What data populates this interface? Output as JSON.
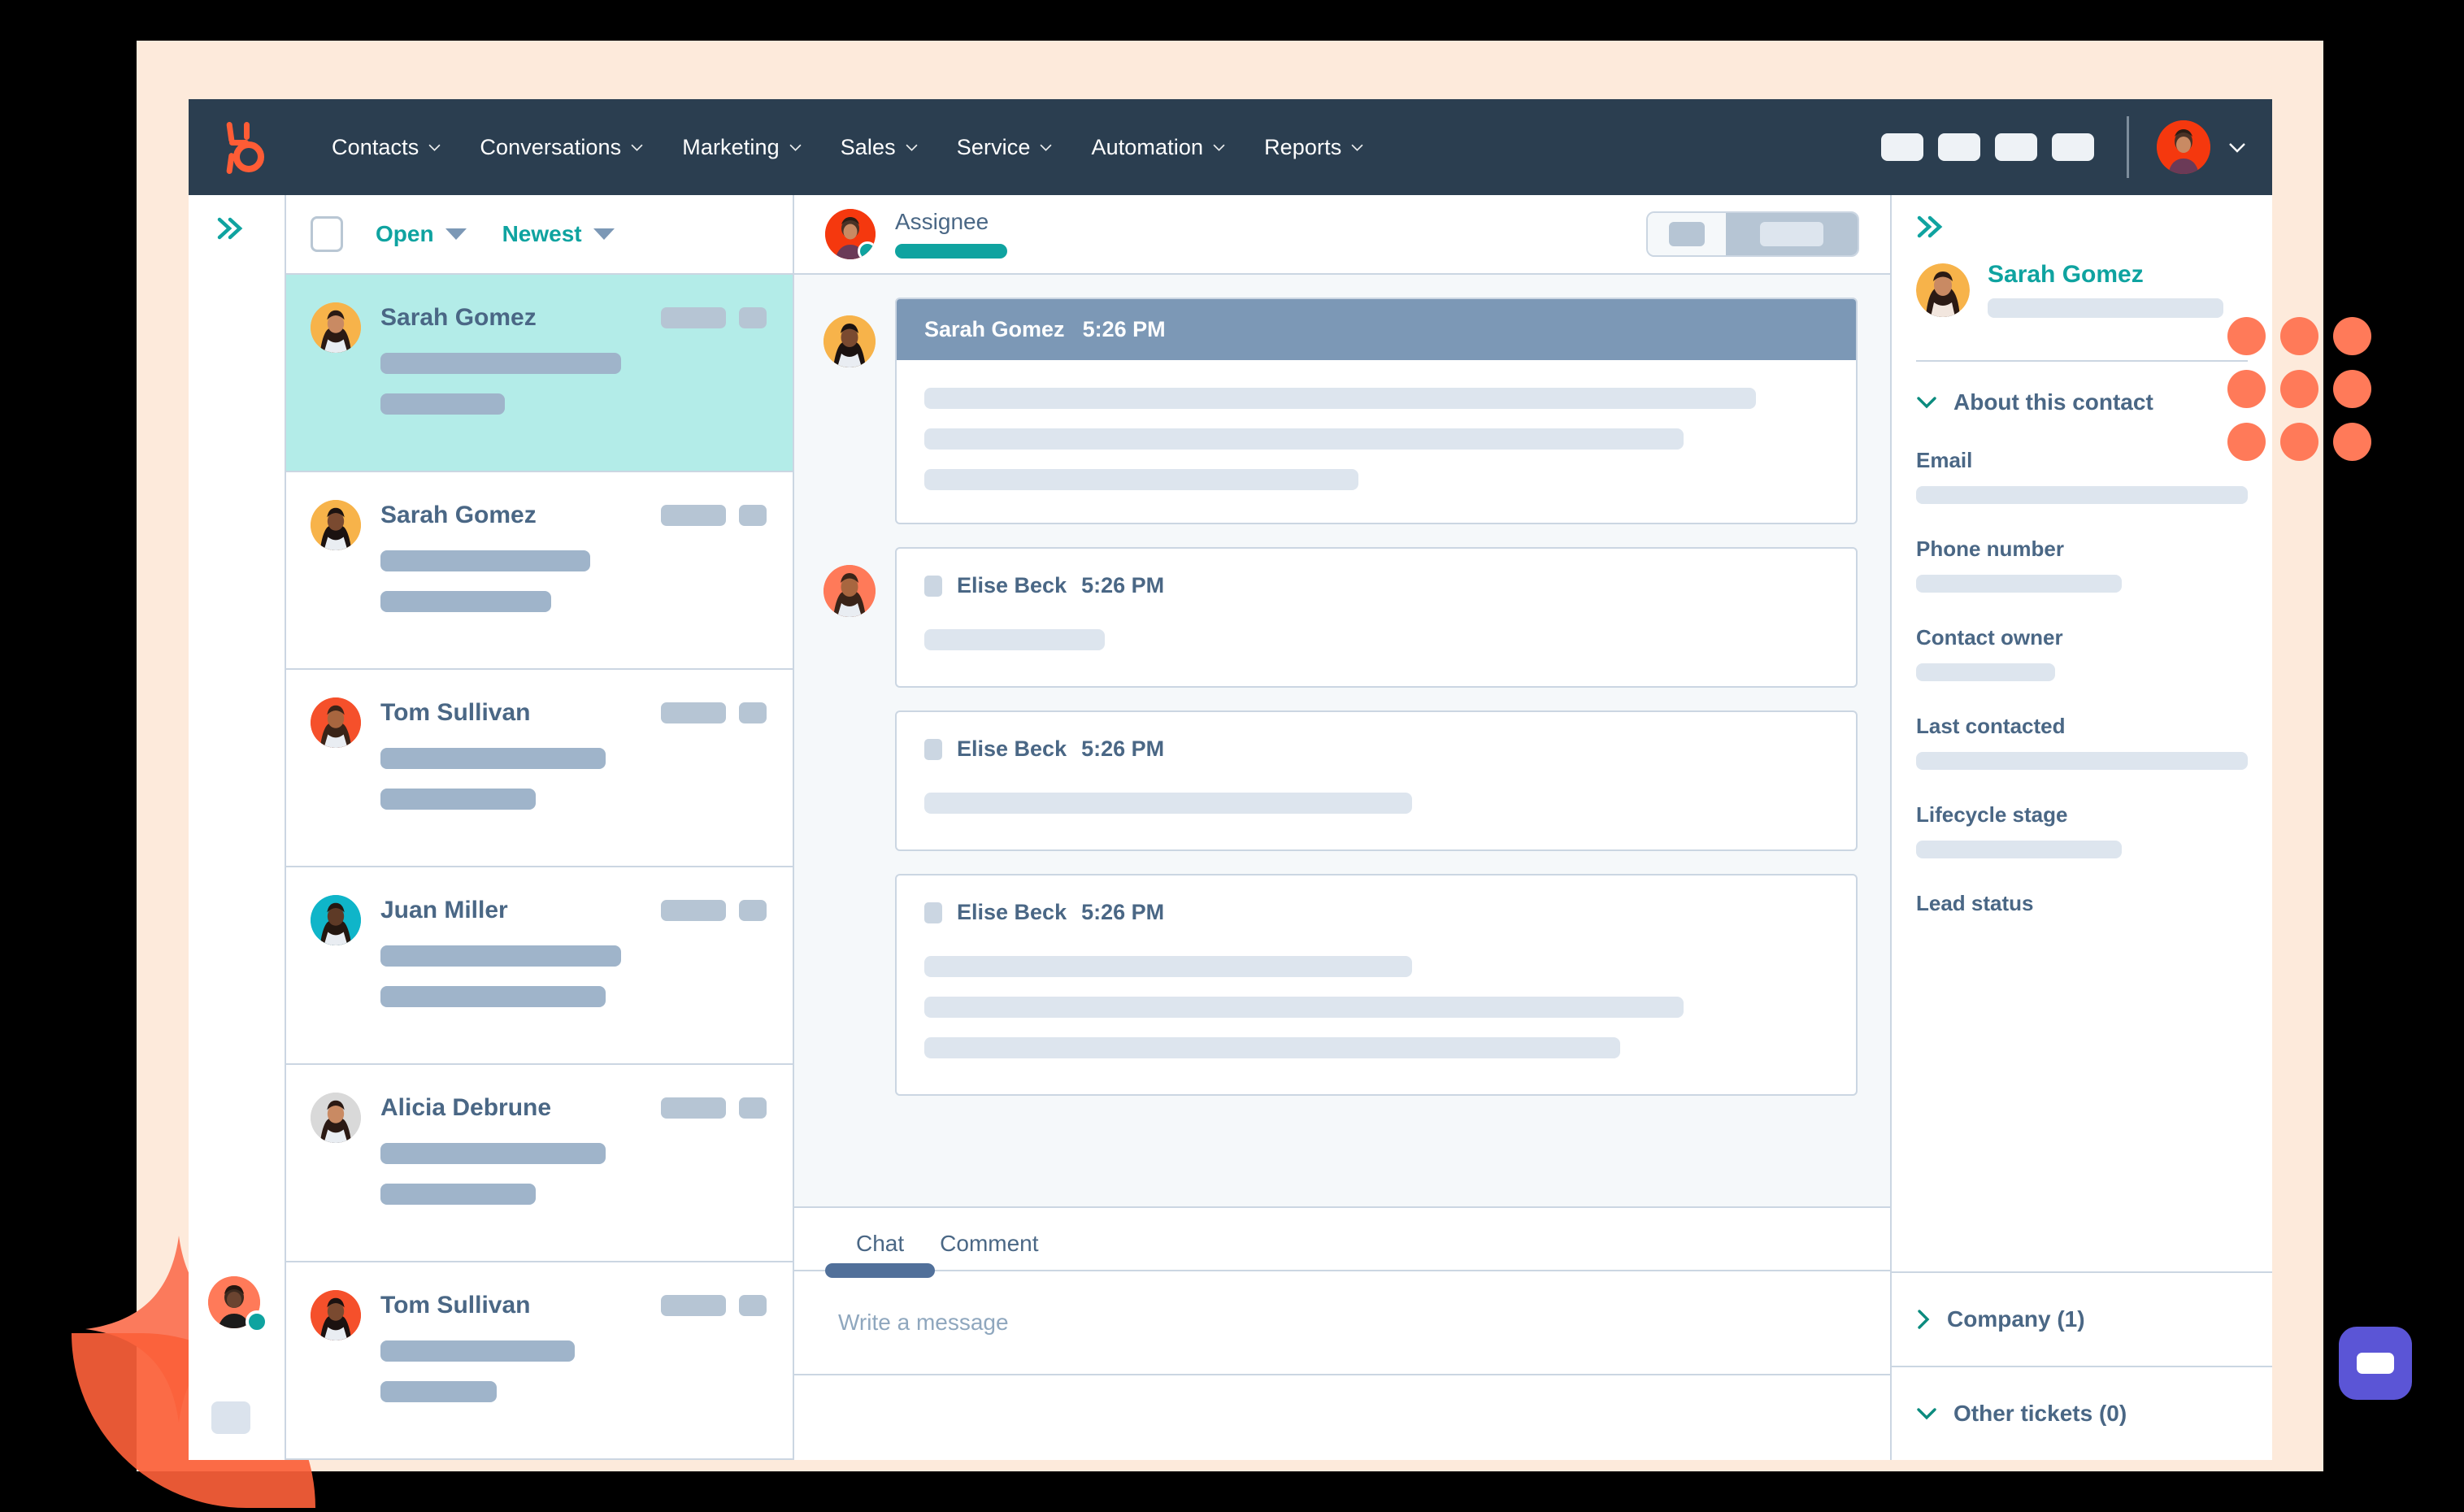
{
  "brand": {
    "accent_teal": "#0fa3a0",
    "accent_orange": "#ff7a59",
    "nav_bg": "#2b3e50",
    "slate": "#4a6785",
    "selected_row": "#b3ece8",
    "widget_purple": "#5b55d6"
  },
  "topnav": {
    "logo_name": "hubspot-sprocket-logo",
    "items": [
      {
        "label": "Contacts"
      },
      {
        "label": "Conversations"
      },
      {
        "label": "Marketing"
      },
      {
        "label": "Sales"
      },
      {
        "label": "Service"
      },
      {
        "label": "Automation"
      },
      {
        "label": "Reports"
      }
    ],
    "action_chip_count": 4,
    "avatar_name": "user-avatar",
    "caret_name": "chevron-down-icon"
  },
  "rail": {
    "collapse_icon": "double-chevron-right-icon",
    "avatar_name": "agent-avatar",
    "status": "online"
  },
  "conversation_list": {
    "toolbar": {
      "select_all_name": "select-all-checkbox",
      "status_filter": "Open",
      "sort_filter": "Newest"
    },
    "items": [
      {
        "name": "Sarah Gomez",
        "avatar_bg": "#f7b34a",
        "selected": true,
        "line1_w": "62%",
        "line2_w": "32%"
      },
      {
        "name": "Sarah Gomez",
        "avatar_bg": "#f7b34a",
        "selected": false,
        "line1_w": "54%",
        "line2_w": "44%"
      },
      {
        "name": "Tom Sullivan",
        "avatar_bg": "#f5502b",
        "selected": false,
        "line1_w": "58%",
        "line2_w": "40%"
      },
      {
        "name": "Juan Miller",
        "avatar_bg": "#0fb5c9",
        "selected": false,
        "line1_w": "62%",
        "line2_w": "58%"
      },
      {
        "name": "Alicia Debrune",
        "avatar_bg": "#d9d9d9",
        "selected": false,
        "line1_w": "58%",
        "line2_w": "40%"
      },
      {
        "name": "Tom Sullivan",
        "avatar_bg": "#f5502b",
        "selected": false,
        "line1_w": "50%",
        "line2_w": "30%"
      }
    ]
  },
  "thread": {
    "header": {
      "avatar_name": "assignee-avatar",
      "label": "Assignee",
      "status": "online",
      "segment_control_name": "view-toggle"
    },
    "messages": [
      {
        "author": "Sarah Gomez",
        "time": "5:26 PM",
        "style": "filled",
        "avatar_bg": "#f7b34a",
        "show_avatar": true,
        "lines": [
          "92%",
          "84%",
          "48%"
        ]
      },
      {
        "author": "Elise Beck",
        "time": "5:26 PM",
        "style": "plain",
        "avatar_bg": "#ff7a59",
        "show_avatar": true,
        "lines": [
          "20%"
        ]
      },
      {
        "author": "Elise Beck",
        "time": "5:26 PM",
        "style": "plain",
        "avatar_bg": "#ff7a59",
        "show_avatar": false,
        "lines": [
          "54%"
        ]
      },
      {
        "author": "Elise Beck",
        "time": "5:26 PM",
        "style": "plain",
        "avatar_bg": "#ff7a59",
        "show_avatar": false,
        "lines": [
          "54%",
          "84%",
          "77%"
        ]
      }
    ],
    "composer": {
      "tabs": [
        {
          "label": "Chat",
          "active": true
        },
        {
          "label": "Comment",
          "active": false
        }
      ],
      "placeholder": "Write a message"
    }
  },
  "contact_panel": {
    "collapse_icon": "double-chevron-right-icon",
    "name": "Sarah Gomez",
    "avatar_bg": "#f7b34a",
    "about_section": {
      "label": "About this contact",
      "expanded": true,
      "chevron": "chevron-down-icon"
    },
    "fields": [
      {
        "label": "Email",
        "value_w": "100%",
        "has_value": true
      },
      {
        "label": "Phone number",
        "value_w": "62%",
        "has_value": true
      },
      {
        "label": "Contact owner",
        "value_w": "42%",
        "has_value": true
      },
      {
        "label": "Last contacted",
        "value_w": "100%",
        "has_value": true
      },
      {
        "label": "Lifecycle stage",
        "value_w": "62%",
        "has_value": true
      },
      {
        "label": "Lead status",
        "value_w": "0%",
        "has_value": false
      }
    ],
    "sections": [
      {
        "label": "Company (1)",
        "expanded": false,
        "chevron": "chevron-right-icon"
      },
      {
        "label": "Other tickets (0)",
        "expanded": true,
        "chevron": "chevron-down-icon"
      }
    ]
  },
  "decorations": {
    "star_name": "four-point-star-shape",
    "leaf_name": "leaf-shape",
    "dot_grid_name": "orange-dot-grid",
    "dot_grid_count": 9,
    "chat_widget_name": "chat-widget-button"
  }
}
